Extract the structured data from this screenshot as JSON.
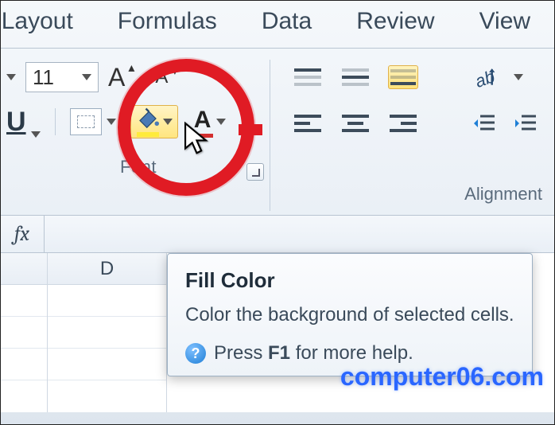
{
  "tabs": {
    "page_layout": "ge Layout",
    "formulas": "Formulas",
    "data": "Data",
    "review": "Review",
    "view": "View"
  },
  "font": {
    "size_value": "11",
    "underline_label": "U",
    "group_label": "Font",
    "fontcolor_A": "A",
    "grow_A": "A",
    "shrink_A": "A"
  },
  "alignment": {
    "group_label": "Alignment"
  },
  "sheet": {
    "col_d": "D",
    "fx": "fx"
  },
  "tooltip": {
    "title": "Fill Color",
    "body": "Color the background of selected cells.",
    "help_prefix": "Press ",
    "help_key": "F1",
    "help_suffix": " for more help."
  },
  "watermark": "computer06.com"
}
